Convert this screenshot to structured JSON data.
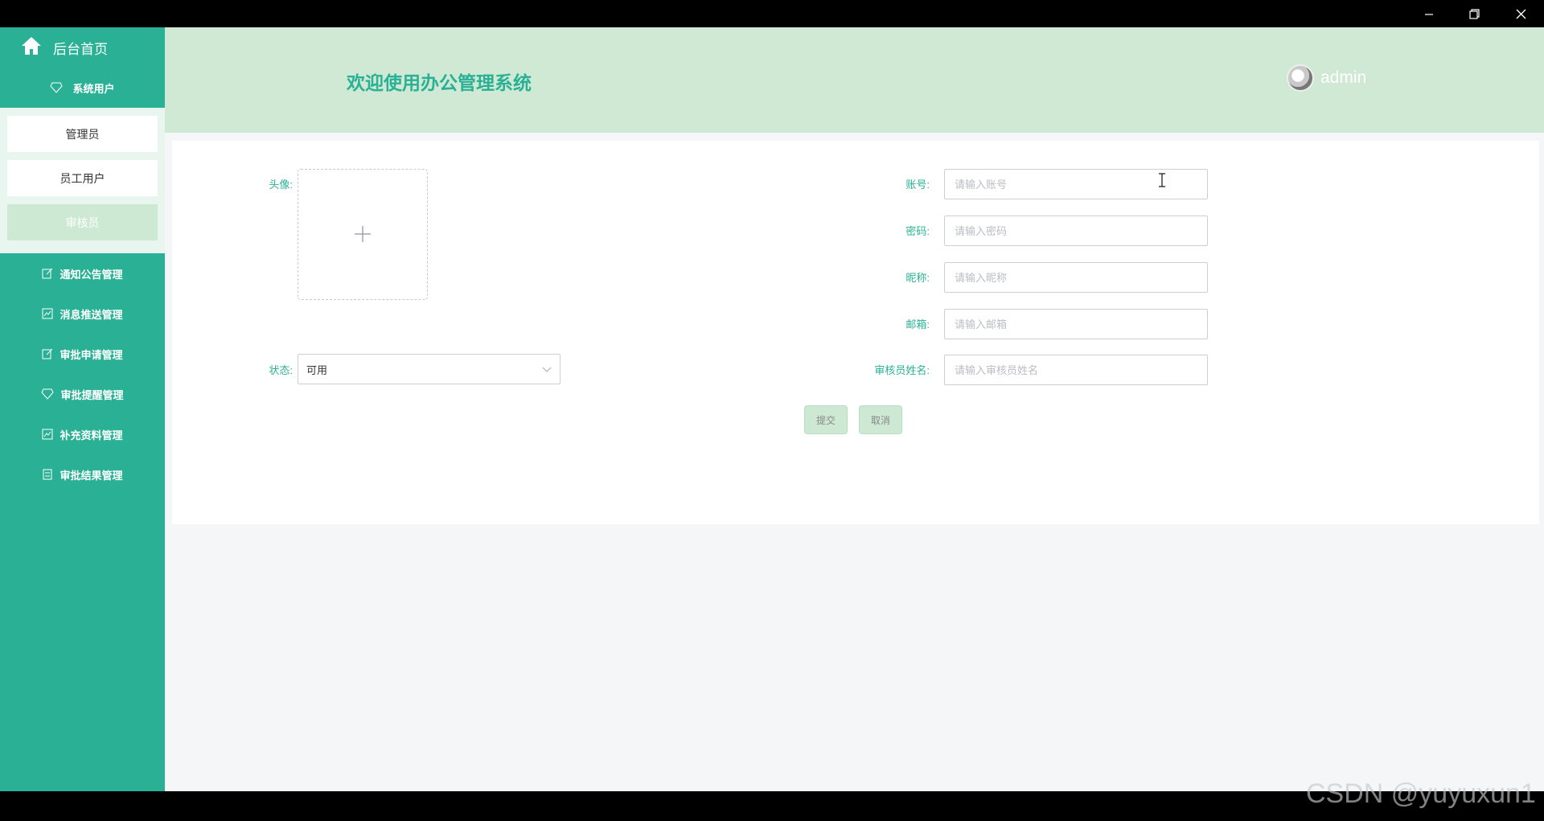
{
  "window": {
    "minimize_icon": "minimize-icon",
    "restore_icon": "restore-icon",
    "close_icon": "close-icon"
  },
  "sidebar": {
    "home_label": "后台首页",
    "section_title": "系统用户",
    "sub_items": [
      {
        "label": "管理员",
        "active": false
      },
      {
        "label": "员工用户",
        "active": false
      },
      {
        "label": "审核员",
        "active": true
      }
    ],
    "menu_items": [
      {
        "label": "通知公告管理",
        "icon": "edit-icon"
      },
      {
        "label": "消息推送管理",
        "icon": "chart-icon"
      },
      {
        "label": "审批申请管理",
        "icon": "edit-icon"
      },
      {
        "label": "审批提醒管理",
        "icon": "diamond-icon"
      },
      {
        "label": "补充资料管理",
        "icon": "chart-icon"
      },
      {
        "label": "审批结果管理",
        "icon": "document-icon"
      }
    ]
  },
  "header": {
    "title": "欢迎使用办公管理系统",
    "username": "admin"
  },
  "form": {
    "avatar_label": "头像:",
    "status_label": "状态:",
    "status_value": "可用",
    "account_label": "账号:",
    "account_placeholder": "请输入账号",
    "password_label": "密码:",
    "password_placeholder": "请输入密码",
    "nickname_label": "昵称:",
    "nickname_placeholder": "请输入昵称",
    "email_label": "邮箱:",
    "email_placeholder": "请输入邮箱",
    "reviewer_name_label": "审核员姓名:",
    "reviewer_name_placeholder": "请输入审核员姓名",
    "submit_label": "提交",
    "cancel_label": "取消"
  },
  "watermark": "CSDN @yuyuxun1",
  "colors": {
    "accent": "#2ab195",
    "header_bg": "#d0e9d4",
    "button_bg": "#cde8d3"
  }
}
